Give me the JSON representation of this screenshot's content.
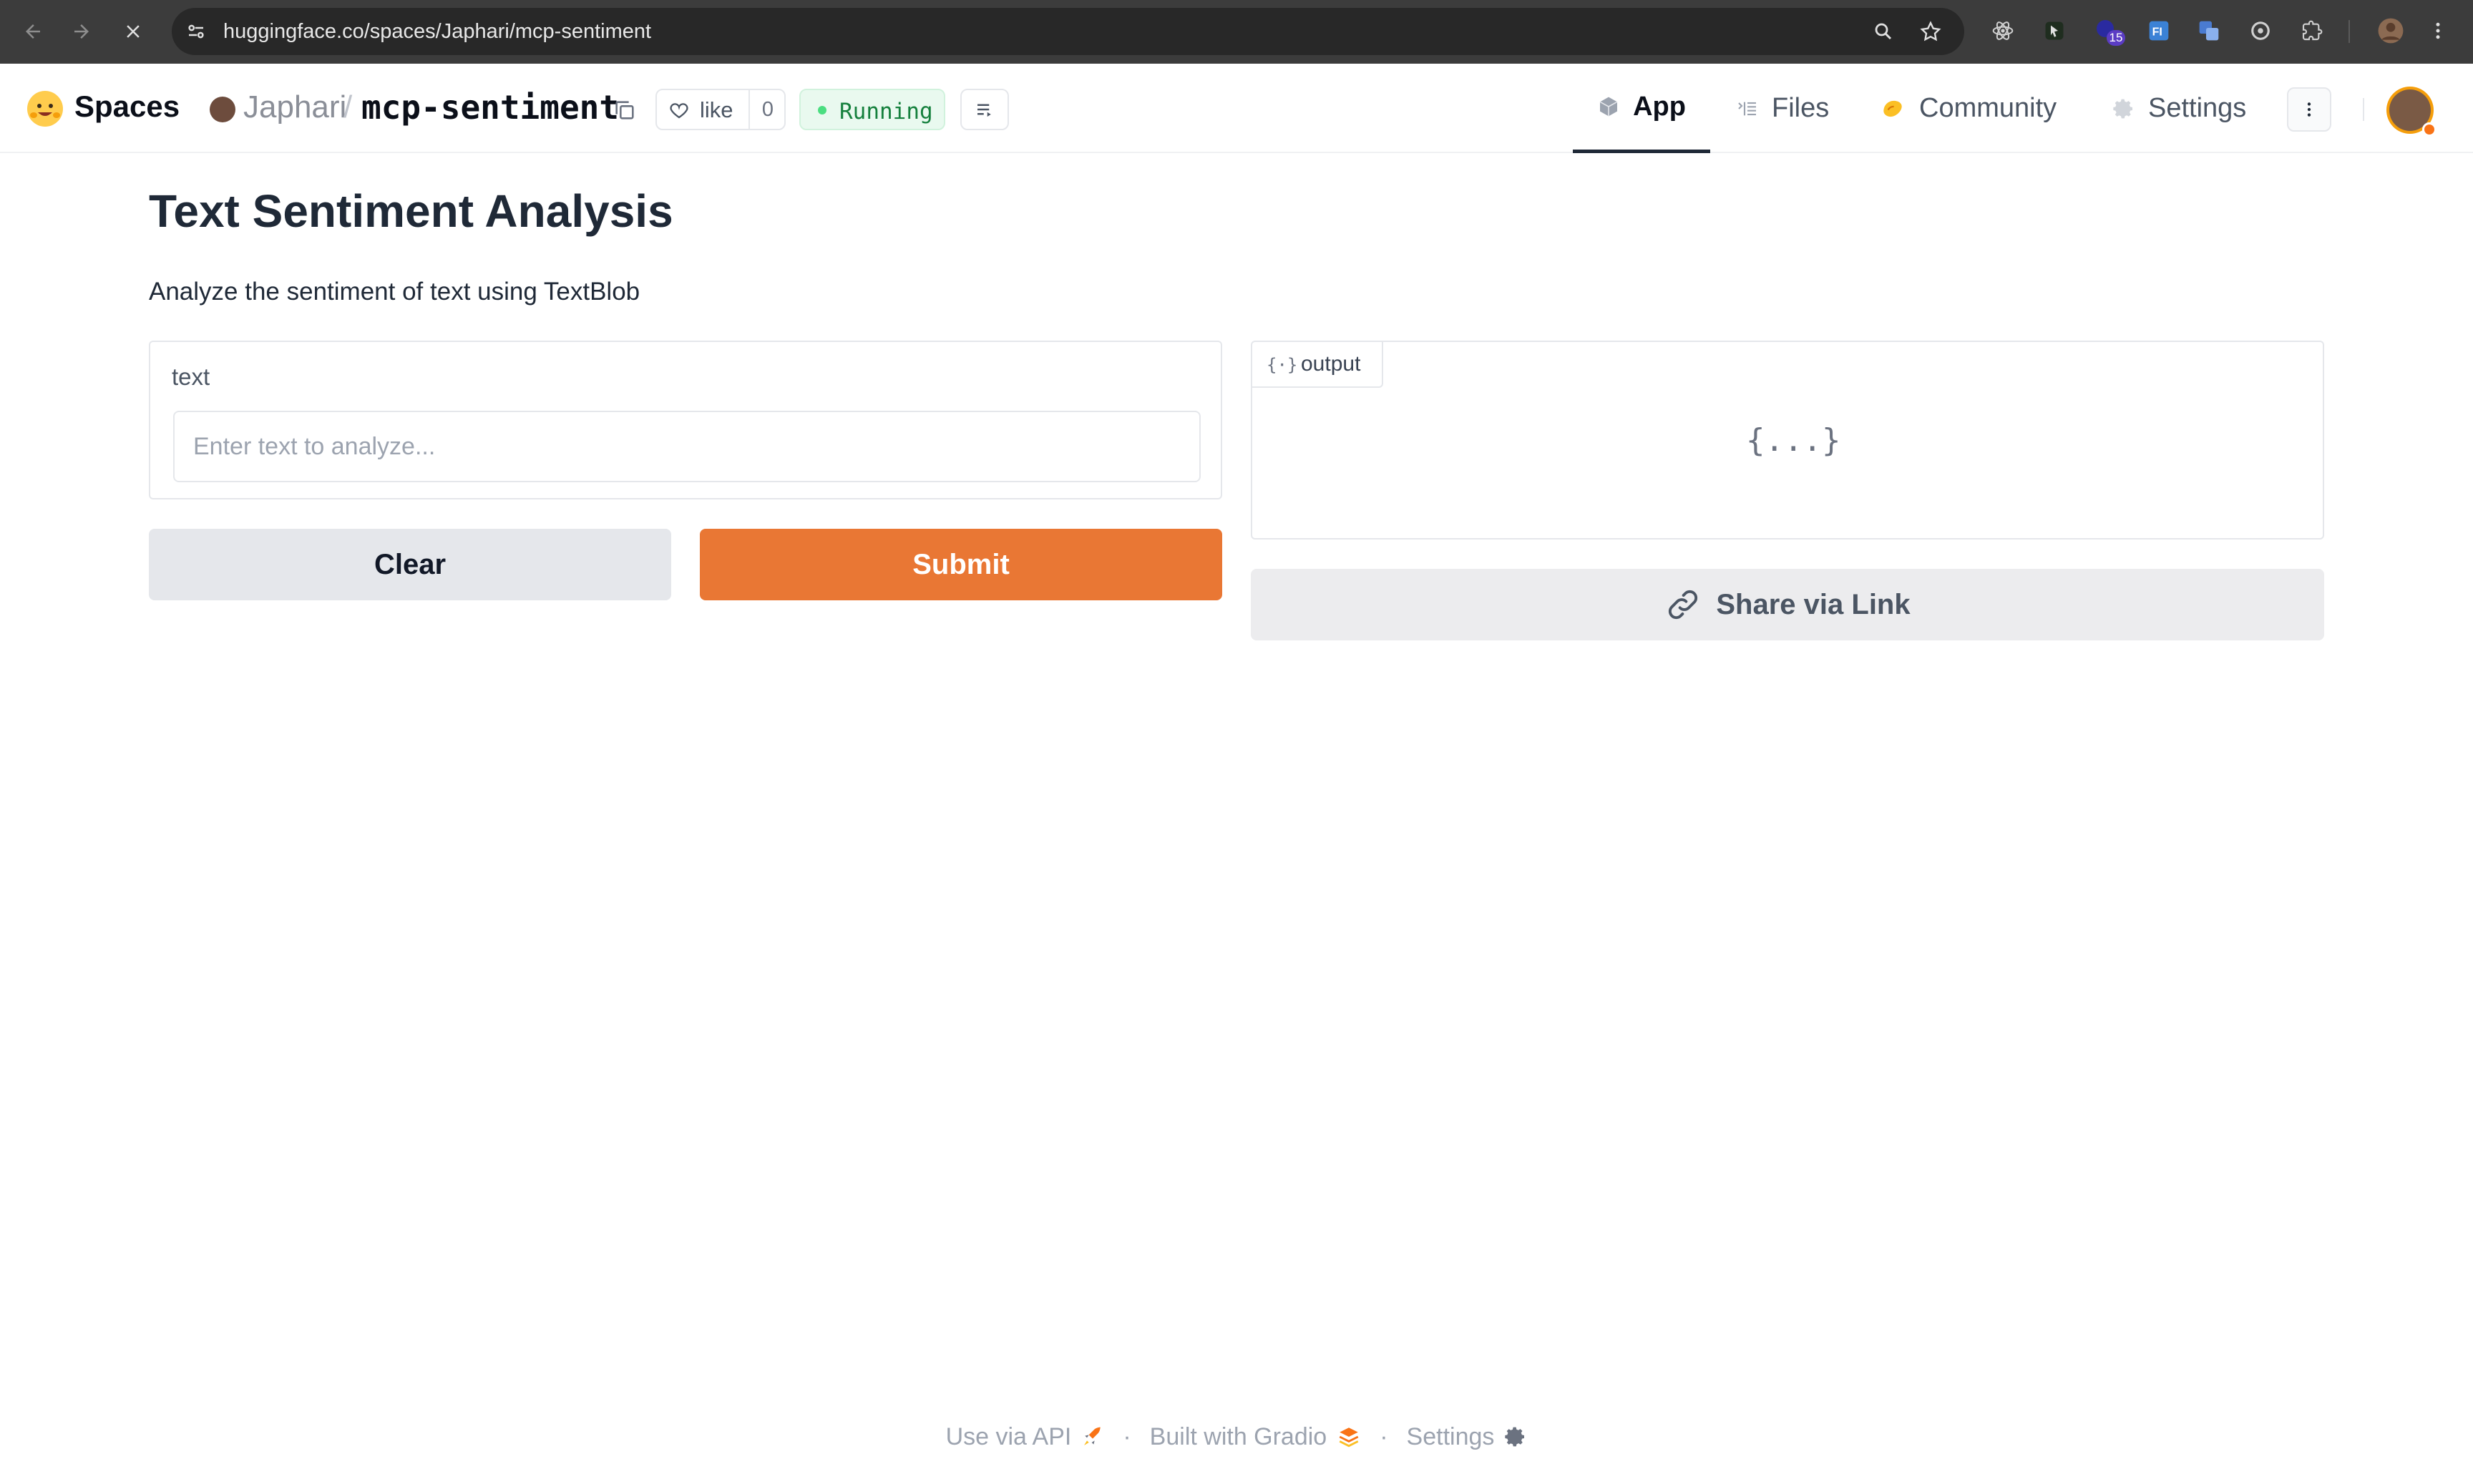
{
  "browser": {
    "url": "huggingface.co/spaces/Japhari/mcp-sentiment",
    "extension_badge_count": "15"
  },
  "header": {
    "brand": "Spaces",
    "owner": "Japhari",
    "separator": "/",
    "repo": "mcp-sentiment",
    "like_label": "like",
    "like_count": "0",
    "status": "Running",
    "tabs": [
      {
        "label": "App",
        "icon": "cube-icon",
        "active": true
      },
      {
        "label": "Files",
        "icon": "files-icon",
        "active": false
      },
      {
        "label": "Community",
        "icon": "community-icon",
        "active": false
      },
      {
        "label": "Settings",
        "icon": "gear-icon",
        "active": false
      }
    ]
  },
  "app": {
    "title": "Text Sentiment Analysis",
    "description": "Analyze the sentiment of text using TextBlob",
    "input_label": "text",
    "input_placeholder": "Enter text to analyze...",
    "input_value": "",
    "clear_label": "Clear",
    "submit_label": "Submit",
    "output_label": "output",
    "output_empty_icon": "{...}",
    "share_label": "Share via Link"
  },
  "footer": {
    "api_label": "Use via API",
    "built_label": "Built with Gradio",
    "settings_label": "Settings"
  },
  "colors": {
    "accent": "#e97734",
    "running": "#15803d",
    "browser_bg": "#3c3c3c"
  }
}
